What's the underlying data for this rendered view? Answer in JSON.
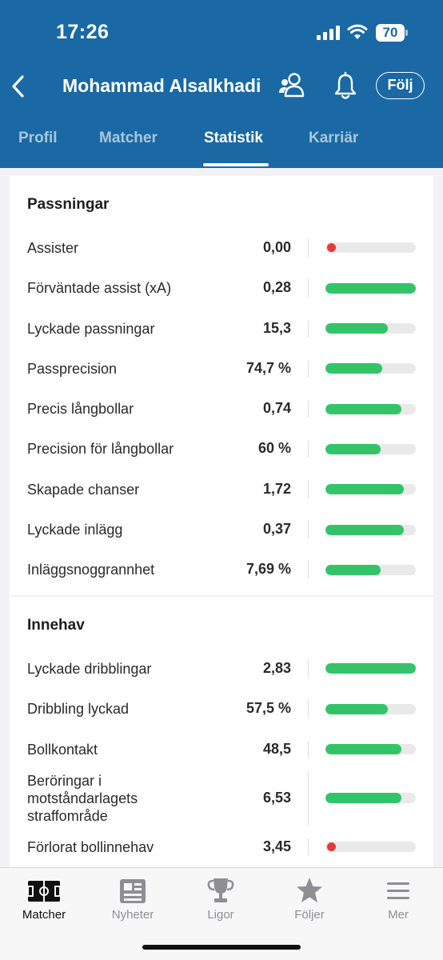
{
  "status_bar": {
    "time": "17:26",
    "battery": "70"
  },
  "header": {
    "title": "Mohammad Alsalkhadi",
    "follow_label": "Följ"
  },
  "tabs": [
    {
      "label": "Profil"
    },
    {
      "label": "Matcher"
    },
    {
      "label": "Statistik",
      "active": true
    },
    {
      "label": "Karriär"
    }
  ],
  "sections": [
    {
      "title": "Passningar",
      "rows": [
        {
          "label": "Assister",
          "value": "0,00",
          "percentile": 0.02
        },
        {
          "label": "Förväntade assist (xA)",
          "value": "0,28",
          "percentile": 1.0
        },
        {
          "label": "Lyckade passningar",
          "value": "15,3",
          "percentile": 0.69
        },
        {
          "label": "Passprecision",
          "value": "74,7 %",
          "percentile": 0.63
        },
        {
          "label": "Precis långbollar",
          "value": "0,74",
          "percentile": 0.84
        },
        {
          "label": "Precision för långbollar",
          "value": "60 %",
          "percentile": 0.61
        },
        {
          "label": "Skapade chanser",
          "value": "1,72",
          "percentile": 0.87
        },
        {
          "label": "Lyckade inlägg",
          "value": "0,37",
          "percentile": 0.87
        },
        {
          "label": "Inläggsnoggrannhet",
          "value": "7,69 %",
          "percentile": 0.61
        }
      ]
    },
    {
      "title": "Innehav",
      "rows": [
        {
          "label": "Lyckade dribblingar",
          "value": "2,83",
          "percentile": 1.0
        },
        {
          "label": "Dribbling lyckad",
          "value": "57,5 %",
          "percentile": 0.69
        },
        {
          "label": "Bollkontakt",
          "value": "48,5",
          "percentile": 0.84
        },
        {
          "label": "Beröringar i motståndarlagets straffområde",
          "label_lines": [
            "Beröringar i",
            "motståndarlagets",
            "straffområde"
          ],
          "value": "6,53",
          "percentile": 0.84
        },
        {
          "label": "Förlorat bollinnehav",
          "value": "3,45",
          "percentile": 0.02
        }
      ]
    }
  ],
  "bottom_nav": [
    {
      "label": "Matcher",
      "icon": "pitch-icon",
      "active": true
    },
    {
      "label": "Nyheter",
      "icon": "news-icon"
    },
    {
      "label": "Ligor",
      "icon": "trophy-icon"
    },
    {
      "label": "Följer",
      "icon": "star-icon"
    },
    {
      "label": "Mer",
      "icon": "menu-icon"
    }
  ],
  "colors": {
    "header": "#1a69a4",
    "bar_good": "#33c46a",
    "bar_bad": "#e33b3b",
    "bar_track": "#e9e9ea"
  }
}
